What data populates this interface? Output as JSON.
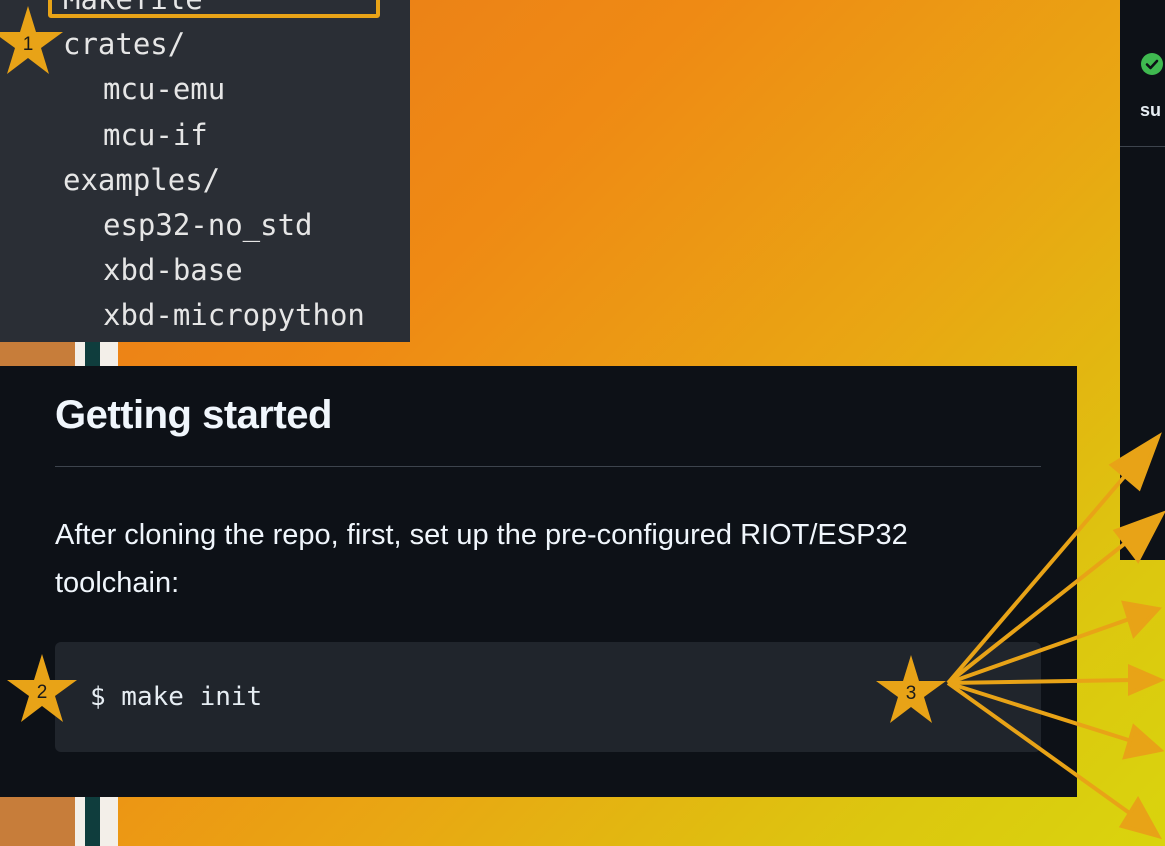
{
  "tree": {
    "items": [
      {
        "label": "Makefile",
        "indent": 0
      },
      {
        "label": "crates/",
        "indent": 0
      },
      {
        "label": "mcu-emu",
        "indent": 1
      },
      {
        "label": "mcu-if",
        "indent": 1
      },
      {
        "label": "examples/",
        "indent": 0
      },
      {
        "label": "esp32-no_std",
        "indent": 1
      },
      {
        "label": "xbd-base",
        "indent": 1
      },
      {
        "label": "xbd-micropython",
        "indent": 1
      }
    ]
  },
  "status": {
    "icon": "check-circle-icon",
    "partial_text": "su",
    "color": "#3fb950"
  },
  "doc": {
    "heading": "Getting started",
    "paragraph": "After cloning the repo, first, set up the pre-configured RIOT/ESP32 toolchain:",
    "command": "$ make init"
  },
  "annotations": {
    "markers": [
      "1",
      "2",
      "3"
    ],
    "color": "#e8a317"
  },
  "colors": {
    "panel_dark": "#0d1117",
    "tree_bg": "#2a2e35",
    "code_bg": "#20252c",
    "accent_orange": "#e8a317"
  }
}
